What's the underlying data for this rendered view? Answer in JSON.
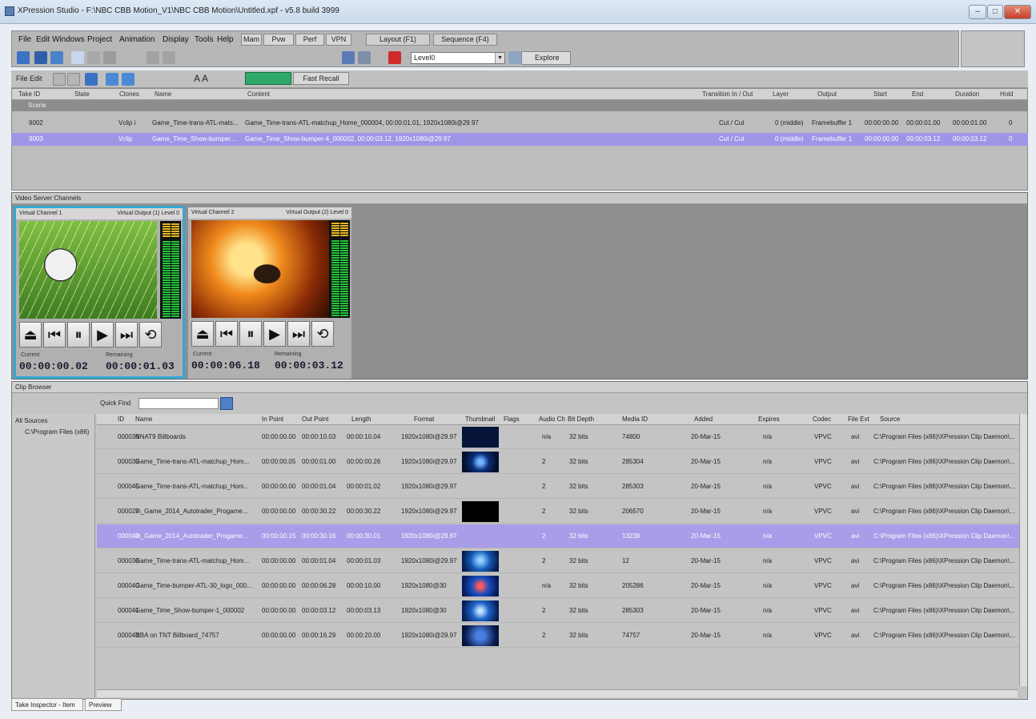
{
  "window": {
    "title": "XPression Studio - F:\\NBC CBB Motion_V1\\NBC CBB Motion\\Untitled.xpf - v5.8 build 3999",
    "controls": [
      "minimize",
      "maximize",
      "close"
    ]
  },
  "menu": {
    "items": [
      "File",
      "Edit",
      "Windows",
      "Project",
      "Animation",
      "Display",
      "Tools",
      "Help"
    ],
    "modes": [
      "Mam",
      "Pvw",
      "Perf",
      "VPN"
    ],
    "layout_tabs": [
      "Layout (F1)",
      "Sequence (F4)"
    ],
    "level_select": "Level0",
    "explore_label": "Explore"
  },
  "sequence_toolbar": {
    "label": "File Edit",
    "font_icons": "A A",
    "fast_recall": "Fast Recall"
  },
  "sequence_grid": {
    "columns": [
      "Take ID",
      "State",
      "Clones",
      "Name",
      "Content",
      "Transition In / Out",
      "Layer",
      "Output",
      "Start",
      "End",
      "Duration",
      "Hold"
    ],
    "group_label": "Scene",
    "rows": [
      {
        "take_id": "9002",
        "clones": "Vclip i",
        "name": "Game_Time-trans-ATL-mats...",
        "content": "Game_Time-trans-ATL-matchup_Home_000004, 00:00:01.01, 1920x1080i@29.97",
        "transition": "Cut / Cut",
        "layer": "0 (middle)",
        "output": "Framebuffer 1",
        "start": "00:00:00.00",
        "end": "00:00:01.00",
        "duration": "00:00:01.00",
        "hold": "0"
      },
      {
        "take_id": "9003",
        "clones": "Vclip",
        "name": "Game_Time_Show-bumper...",
        "content": "Game_Time_Show-bumper-4_000002, 00:00:03.12, 1920x1080i@29.97",
        "transition": "Cut / Cut",
        "layer": "0 (middle)",
        "output": "Framebuffer 1",
        "start": "00:00:00.00",
        "end": "00:00:03.12",
        "duration": "00:00:03.12",
        "hold": "0"
      }
    ]
  },
  "video_server": {
    "panel_title": "Video Server Channels",
    "channels": [
      {
        "name": "Virtual Channel 1",
        "output": "Virtual Output (1) Level 0",
        "current_label": "Current",
        "current": "00:00:00.02",
        "remaining_label": "Remaining",
        "remaining": "00:00:01.03",
        "active": true
      },
      {
        "name": "Virtual Channel 2",
        "output": "Virtual Output (2) Level 0",
        "current_label": "Current",
        "current": "00:00:06.18",
        "remaining_label": "Remaining",
        "remaining": "00:00:03.12",
        "active": false
      }
    ]
  },
  "clip_browser": {
    "panel_title": "Clip Browser",
    "quickfind_label": "Quick Find",
    "quickfind_value": "",
    "source_tree": {
      "root": "All Sources",
      "child": "C:\\Program Files (x86)"
    },
    "columns": [
      "ID",
      "Name",
      "In Point",
      "Out Point",
      "Length",
      "Format",
      "Thumbnail",
      "Flags",
      "Audio Ch",
      "Bit Depth",
      "Media ID",
      "Added",
      "Expires",
      "Codec",
      "File Ext",
      "Source"
    ],
    "rows": [
      {
        "id": "000036",
        "name": "NNAT9 Billboards",
        "in": "00:00:00.00",
        "out": "00:00:10.03",
        "length": "00:00:10.04",
        "format": "1920x1080i@29.97",
        "audio": "n/a",
        "bitdepth": "32 bits",
        "media_id": "74800",
        "added": "20-Mar-15",
        "expires": "n/a",
        "codec": "VPVC",
        "ext": "avi",
        "source": "C:\\Program Files (x86)\\XPression Clip Daemon\\..."
      },
      {
        "id": "000039",
        "name": "Game_Time-trans-ATL-matchup_Hom...",
        "in": "00:00:00.05",
        "out": "00:00:01.00",
        "length": "00:00:00.26",
        "format": "1920x1080i@29.97",
        "audio": "2",
        "bitdepth": "32 bits",
        "media_id": "285304",
        "added": "20-Mar-15",
        "expires": "n/a",
        "codec": "VPVC",
        "ext": "avi",
        "source": "C:\\Program Files (x86)\\XPression Clip Daemon\\..."
      },
      {
        "id": "000045",
        "name": "Game_Time-trans-ATL-matchup_Hom...",
        "in": "00:00:00.00",
        "out": "00:00:01.04",
        "length": "00:00:01.02",
        "format": "1920x1080i@29.97",
        "audio": "2",
        "bitdepth": "32 bits",
        "media_id": "285303",
        "added": "20-Mar-15",
        "expires": "n/a",
        "codec": "VPVC",
        "ext": "avi",
        "source": "C:\\Program Files (x86)\\XPression Clip Daemon\\..."
      },
      {
        "id": "000027",
        "name": "In_Game_2014_Autotrader_Progame...",
        "in": "00:00:00.00",
        "out": "00:00:30.22",
        "length": "00:00:30.22",
        "format": "1920x1080i@29.97",
        "audio": "2",
        "bitdepth": "32 bits",
        "media_id": "206570",
        "added": "20-Mar-15",
        "expires": "n/a",
        "codec": "VPVC",
        "ext": "avi",
        "source": "C:\\Program Files (x86)\\XPression Clip Daemon\\..."
      },
      {
        "id": "000040",
        "name": "In_Game_2014_Autotrader_Progame...",
        "in": "00:00:00.15",
        "out": "00:00:30.16",
        "length": "00:00:30.01",
        "format": "1920x1080i@29.97",
        "audio": "2",
        "bitdepth": "32 bits",
        "media_id": "13239",
        "added": "20-Mar-15",
        "expires": "n/a",
        "codec": "VPVC",
        "ext": "avi",
        "source": "C:\\Program Files (x86)\\XPression Clip Daemon\\..."
      },
      {
        "id": "000038",
        "name": "Game_Time-trans-ATL-matchup_Hom...",
        "in": "00:00:00.00",
        "out": "00:00:01.04",
        "length": "00:00:01.03",
        "format": "1920x1080i@29.97",
        "audio": "2",
        "bitdepth": "32 bits",
        "media_id": "12",
        "added": "20-Mar-15",
        "expires": "n/a",
        "codec": "VPVC",
        "ext": "avi",
        "source": "C:\\Program Files (x86)\\XPression Clip Daemon\\..."
      },
      {
        "id": "000040",
        "name": "Game_Time-bumper-ATL-30_logo_000...",
        "in": "00:00:00.00",
        "out": "00:00:06.28",
        "length": "00:00:10.00",
        "format": "1920x1080@30",
        "audio": "n/a",
        "bitdepth": "32 bits",
        "media_id": "205286",
        "added": "20-Mar-15",
        "expires": "n/a",
        "codec": "VPVC",
        "ext": "avi",
        "source": "C:\\Program Files (x86)\\XPression Clip Daemon\\..."
      },
      {
        "id": "000041",
        "name": "Game_Time_Show-bumper-1_000002",
        "in": "00:00:00.00",
        "out": "00:00:03.12",
        "length": "00:00:03.13",
        "format": "1920x1080@30",
        "audio": "2",
        "bitdepth": "32 bits",
        "media_id": "285303",
        "added": "20-Mar-15",
        "expires": "n/a",
        "codec": "VPVC",
        "ext": "avi",
        "source": "C:\\Program Files (x86)\\XPression Clip Daemon\\..."
      },
      {
        "id": "000042",
        "NAME_FIX": "",
        "name": "NBA on TNT Billboard_74757",
        "in": "00:00:00.00",
        "out": "00:00:16.29",
        "length": "00:00:20.00",
        "format": "1920x1080i@29.97",
        "audio": "2",
        "bitdepth": "32 bits",
        "media_id": "74757",
        "added": "20-Mar-15",
        "expires": "n/a",
        "codec": "VPVC",
        "ext": "avi",
        "source": "C:\\Program Files (x86)\\XPression Clip Daemon\\..."
      }
    ],
    "selected_row_index": 4
  },
  "bottom_tabs": [
    "Take Inspector - Item",
    "Preview"
  ],
  "colors": {
    "selection": "#a79de8",
    "active_channel_border": "#34a6d8",
    "fast_recall": "#2fa96a"
  }
}
